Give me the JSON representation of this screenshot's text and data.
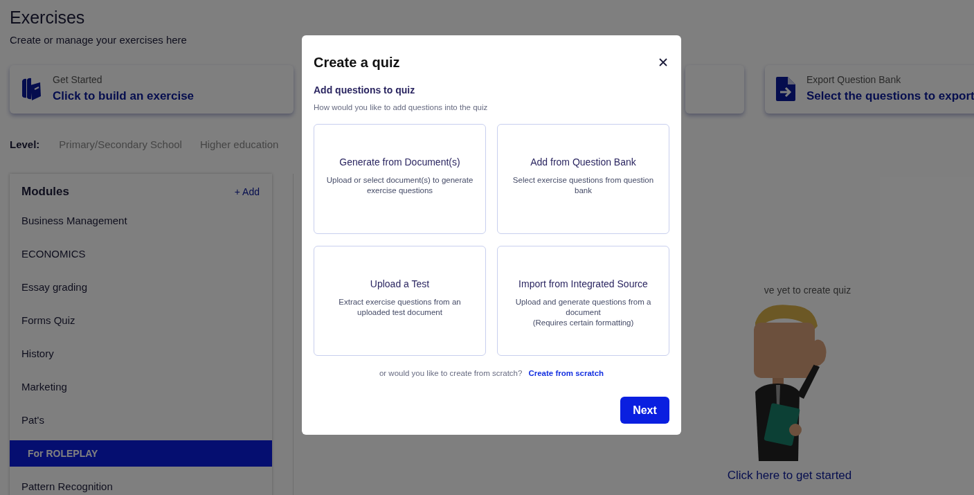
{
  "page": {
    "title": "Exercises",
    "subtitle": "Create or manage your exercises here"
  },
  "action_cards": [
    {
      "kind": "build",
      "label": "Get Started",
      "link": "Click to build an exercise"
    },
    {
      "kind": "blank"
    },
    {
      "kind": "export",
      "label": "Export Question Bank",
      "link": "Select the questions to export"
    }
  ],
  "level": {
    "label": "Level:",
    "options": [
      {
        "label": "Primary/Secondary School",
        "selected": false
      },
      {
        "label": "Higher education",
        "selected": false
      }
    ]
  },
  "modules": {
    "title": "Modules",
    "add": "+ Add",
    "items": [
      {
        "label": "Business Management",
        "selected": false
      },
      {
        "label": "ECONOMICS",
        "selected": false
      },
      {
        "label": "Essay grading",
        "selected": false
      },
      {
        "label": "Forms Quiz",
        "selected": false
      },
      {
        "label": "History",
        "selected": false
      },
      {
        "label": "Marketing",
        "selected": false
      },
      {
        "label": "Pat's",
        "selected": false,
        "children": [
          {
            "label": "For ROLEPLAY",
            "selected": true
          }
        ]
      },
      {
        "label": "Pattern Recognition",
        "selected": false
      }
    ]
  },
  "empty_state": {
    "message": "ve yet to create quiz",
    "link": "Click here to get started"
  },
  "dialog": {
    "title": "Create a quiz",
    "heading": "Add questions to quiz",
    "hint": "How would you like to add questions into the quiz",
    "options": [
      {
        "title": "Generate from Document(s)",
        "description": [
          "Upload or select document(s) to generate exercise questions"
        ]
      },
      {
        "title": "Add from Question Bank",
        "description": [
          "Select exercise questions from question bank"
        ]
      },
      {
        "title": "Upload a Test",
        "description": [
          "Extract exercise questions from an uploaded test document"
        ]
      },
      {
        "title": "Import from Integrated Source",
        "description": [
          "Upload and generate questions from a document",
          "(Requires certain formatting)"
        ]
      }
    ],
    "scratch_prompt": "or would you like to create from scratch?",
    "scratch_link": "Create from scratch",
    "next": "Next"
  }
}
